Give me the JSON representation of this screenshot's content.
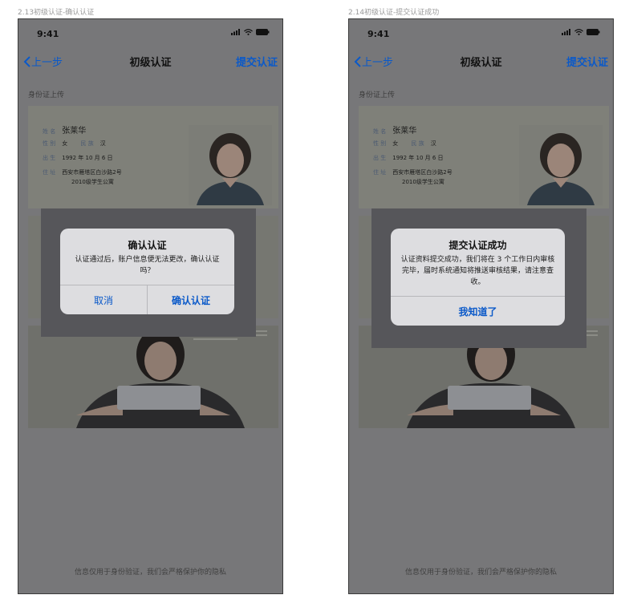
{
  "screens": [
    {
      "artboard_title": "2.13初级认证-确认认证",
      "status_time": "9:41",
      "nav": {
        "back_label": "上一步",
        "title": "初级认证",
        "submit_label": "提交认证"
      },
      "section_label": "身份证上传",
      "id_card": {
        "name_label": "姓 名",
        "name": "张莱华",
        "sex_label": "性 别",
        "sex": "女",
        "ethnic_label": "民 族",
        "ethnic": "汉",
        "birth_label": "出 生",
        "birth": "1992 年 10 月 6 日",
        "address_label": "住 址",
        "address_line1": "西安市雁塔区白沙路2号",
        "address_line2": "2010级学生公寓"
      },
      "dialog": {
        "title": "确认认证",
        "body": "认证通过后，账户信息便无法更改，确认认证吗？",
        "cancel_label": "取消",
        "confirm_label": "确认认证"
      },
      "privacy_note": "信息仅用于身份验证，我们会严格保护你的隐私"
    },
    {
      "artboard_title": "2.14初级认证-提交认证成功",
      "status_time": "9:41",
      "nav": {
        "back_label": "上一步",
        "title": "初级认证",
        "submit_label": "提交认证"
      },
      "section_label": "身份证上传",
      "id_card": {
        "name_label": "姓 名",
        "name": "张莱华",
        "sex_label": "性 别",
        "sex": "女",
        "ethnic_label": "民 族",
        "ethnic": "汉",
        "birth_label": "出 生",
        "birth": "1992 年 10 月 6 日",
        "address_label": "住 址",
        "address_line1": "西安市雁塔区白沙路2号",
        "address_line2": "2010级学生公寓"
      },
      "dialog": {
        "title": "提交认证成功",
        "body": "认证资料提交成功，我们将在 3 个工作日内审核完毕，届时系统通知将推送审核结果，请注意查收。",
        "ok_label": "我知道了"
      },
      "privacy_note": "信息仅用于身份验证，我们会严格保护你的隐私"
    }
  ],
  "colors": {
    "accent": "#0a59c9",
    "dim_background": "#777779",
    "dialog_background": "#dddde0"
  }
}
